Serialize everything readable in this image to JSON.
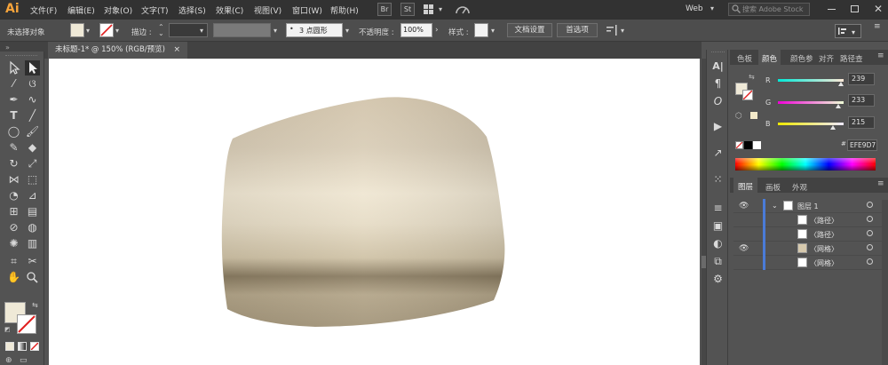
{
  "app": {
    "logo": "Ai"
  },
  "menu": [
    "文件(F)",
    "编辑(E)",
    "对象(O)",
    "文字(T)",
    "选择(S)",
    "效果(C)",
    "视图(V)",
    "窗口(W)",
    "帮助(H)"
  ],
  "menubar_buttons": {
    "bridge": "Br",
    "stock": "St"
  },
  "workspace": "Web",
  "search": {
    "placeholder": "搜索 Adobe Stock"
  },
  "control": {
    "selection_label": "未选择对象",
    "stroke_label": "描边 :",
    "brush_label": "3 点圆形",
    "opacity_label": "不透明度 :",
    "opacity_value": "100%",
    "style_label": "样式 :",
    "doc_setup": "文档设置",
    "prefs": "首选项"
  },
  "document": {
    "tab_title": "未标题-1* @ 150% (RGB/预览)",
    "close_glyph": "×"
  },
  "color_panel": {
    "tabs": [
      "色板",
      "颜色",
      "颜色参",
      "对齐",
      "路径查"
    ],
    "active_tab": "颜色",
    "channels": [
      {
        "label": "R",
        "value": "239",
        "fraction": 0.94
      },
      {
        "label": "G",
        "value": "233",
        "fraction": 0.91
      },
      {
        "label": "B",
        "value": "215",
        "fraction": 0.84
      }
    ],
    "hex": "EFE9D7"
  },
  "layers_panel": {
    "tabs": [
      "图层",
      "画板",
      "外观"
    ],
    "active_tab": "图层",
    "layer_name": "图层 1",
    "items": [
      "〈路径〉",
      "〈路径〉",
      "〈网格〉",
      "〈网格〉"
    ]
  },
  "colors": {
    "fill": "#efe9d7",
    "accent": "#4a7bd8",
    "logo": "#f7a43b"
  }
}
